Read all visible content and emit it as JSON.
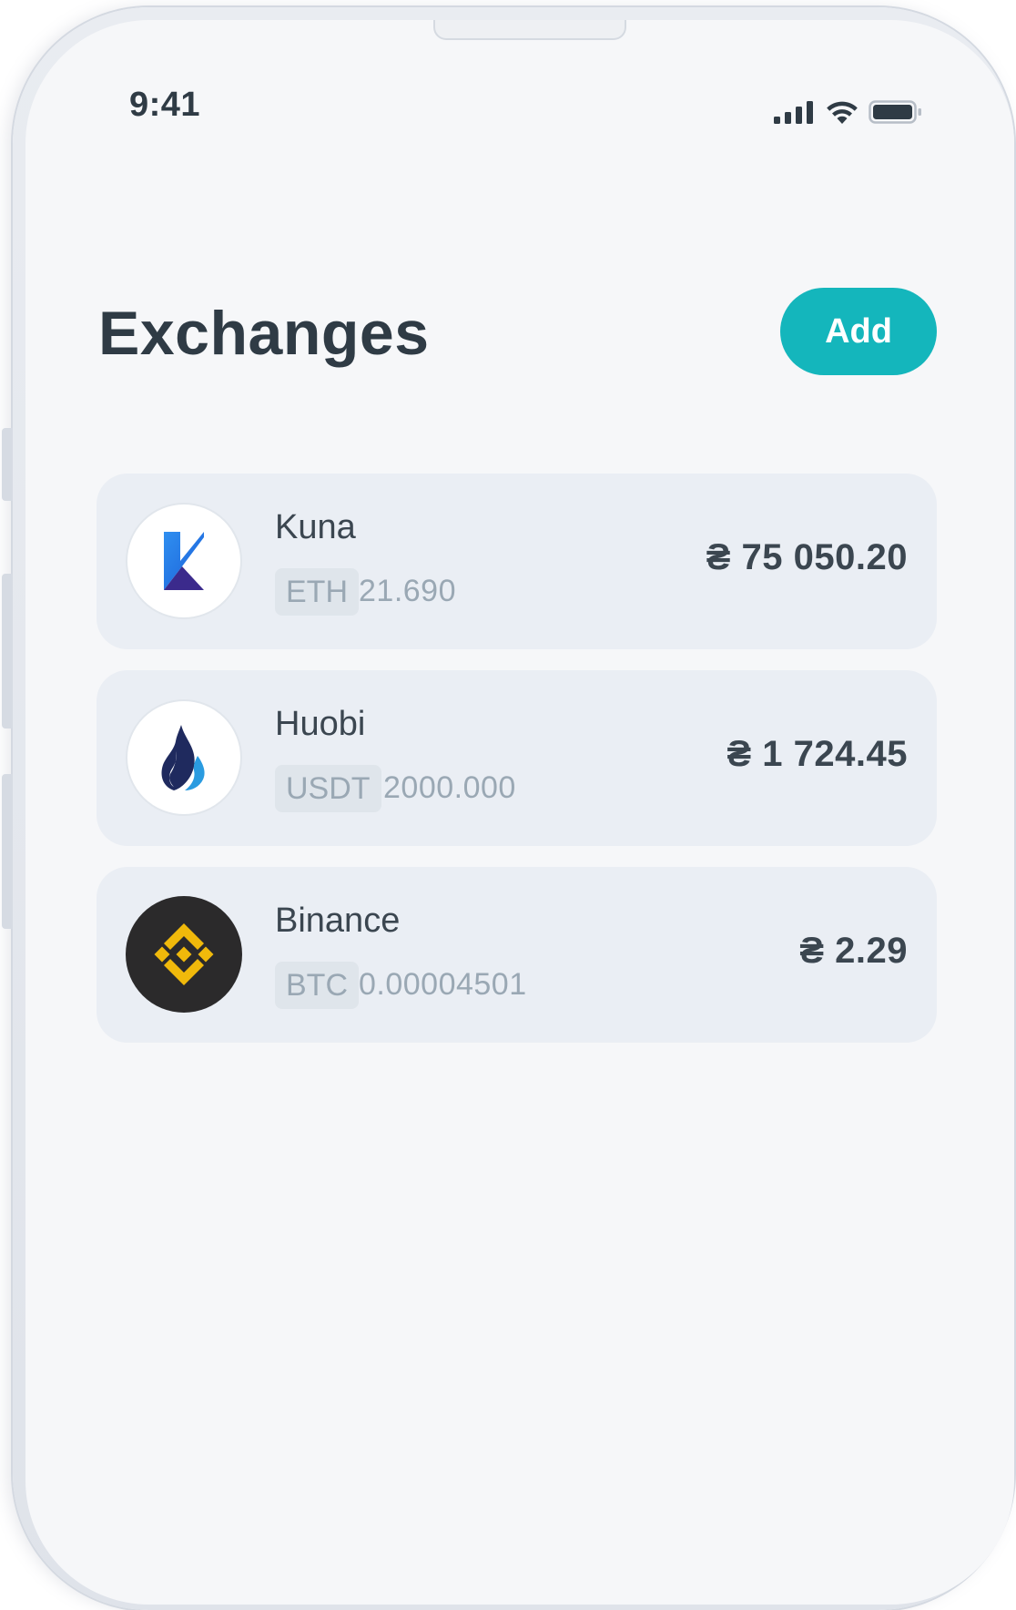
{
  "status_bar": {
    "time": "9:41",
    "icons": [
      "cellular-signal-icon",
      "wifi-icon",
      "battery-icon"
    ]
  },
  "header": {
    "title": "Exchanges",
    "add_label": "Add",
    "accent_color": "#14b6bc"
  },
  "exchanges": [
    {
      "name": "Kuna",
      "logo": "kuna-logo-icon",
      "ticker": "ETH",
      "amount": "21.690",
      "fiat_value": "₴ 75 050.20"
    },
    {
      "name": "Huobi",
      "logo": "huobi-logo-icon",
      "ticker": "USDT",
      "amount": "2000.000",
      "fiat_value": "₴ 1 724.45"
    },
    {
      "name": "Binance",
      "logo": "binance-logo-icon",
      "ticker": "BTC",
      "amount": "0.00004501",
      "fiat_value": "₴ 2.29"
    }
  ]
}
